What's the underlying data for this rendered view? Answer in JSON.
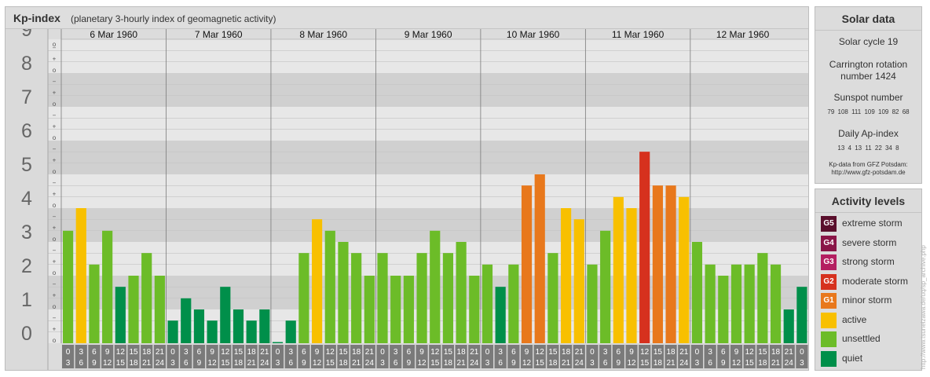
{
  "chart_data": {
    "type": "bar",
    "title": "Kp-index",
    "subtitle": "(planetary 3-hourly index of geomagnetic activity)",
    "ylim": [
      0,
      9
    ],
    "y_ticks": [
      "0",
      "1",
      "2",
      "3",
      "4",
      "5",
      "6",
      "7",
      "8",
      "9"
    ],
    "minor_marks": [
      "o",
      "+",
      "−"
    ],
    "days": [
      "6 Mar 1960",
      "7 Mar 1960",
      "8 Mar 1960",
      "9 Mar 1960",
      "10 Mar 1960",
      "11 Mar 1960",
      "12 Mar 1960"
    ],
    "interval_labels": [
      [
        "0",
        "3"
      ],
      [
        "3",
        "6"
      ],
      [
        "6",
        "9"
      ],
      [
        "9",
        "12"
      ],
      [
        "12",
        "15"
      ],
      [
        "15",
        "18"
      ],
      [
        "18",
        "21"
      ],
      [
        "21",
        "24"
      ]
    ],
    "values": [
      3.33,
      4.0,
      2.33,
      3.33,
      1.67,
      2.0,
      2.67,
      2.0,
      0.67,
      1.33,
      1.0,
      0.67,
      1.67,
      1.0,
      0.67,
      1.0,
      0.0,
      0.67,
      2.67,
      3.67,
      3.33,
      3.0,
      2.67,
      2.0,
      2.67,
      2.0,
      2.0,
      2.67,
      3.33,
      2.67,
      3.0,
      2.0,
      2.33,
      1.67,
      2.33,
      4.67,
      5.0,
      2.67,
      4.0,
      3.67,
      2.33,
      3.33,
      4.33,
      4.0,
      5.67,
      4.67,
      4.67,
      4.33,
      3.0,
      2.33,
      2.0,
      2.33,
      2.33,
      2.67,
      2.33,
      1.0,
      1.67
    ],
    "grid": true
  },
  "solar_data": {
    "title": "Solar data",
    "solar_cycle": "Solar cycle 19",
    "carrington_line1": "Carrington rotation",
    "carrington_line2": "number 1424",
    "sunspot_title": "Sunspot number",
    "sunspot_values": "79 108 111 109 109 82 68",
    "ap_title": "Daily Ap-index",
    "ap_values": "13 4 13 11 22 34 8",
    "source_line1": "Kp-data from GFZ Potsdam:",
    "source_line2": "http://www.gfz-potsdam.de"
  },
  "activity_levels": {
    "title": "Activity levels",
    "items": [
      {
        "code": "G5",
        "label": "extreme storm",
        "color": "#5a0f2c"
      },
      {
        "code": "G4",
        "label": "severe storm",
        "color": "#8a1547"
      },
      {
        "code": "G3",
        "label": "strong storm",
        "color": "#b41f61"
      },
      {
        "code": "G2",
        "label": "moderate storm",
        "color": "#d6311e"
      },
      {
        "code": "G1",
        "label": "minor storm",
        "color": "#e8781c"
      },
      {
        "code": "",
        "label": "active",
        "color": "#f8c000"
      },
      {
        "code": "",
        "label": "unsettled",
        "color": "#6cbc28"
      },
      {
        "code": "",
        "label": "quiet",
        "color": "#008f4a"
      }
    ]
  },
  "watermark": "http://www.tsuneizawa.de/uq/sp_archive.php"
}
